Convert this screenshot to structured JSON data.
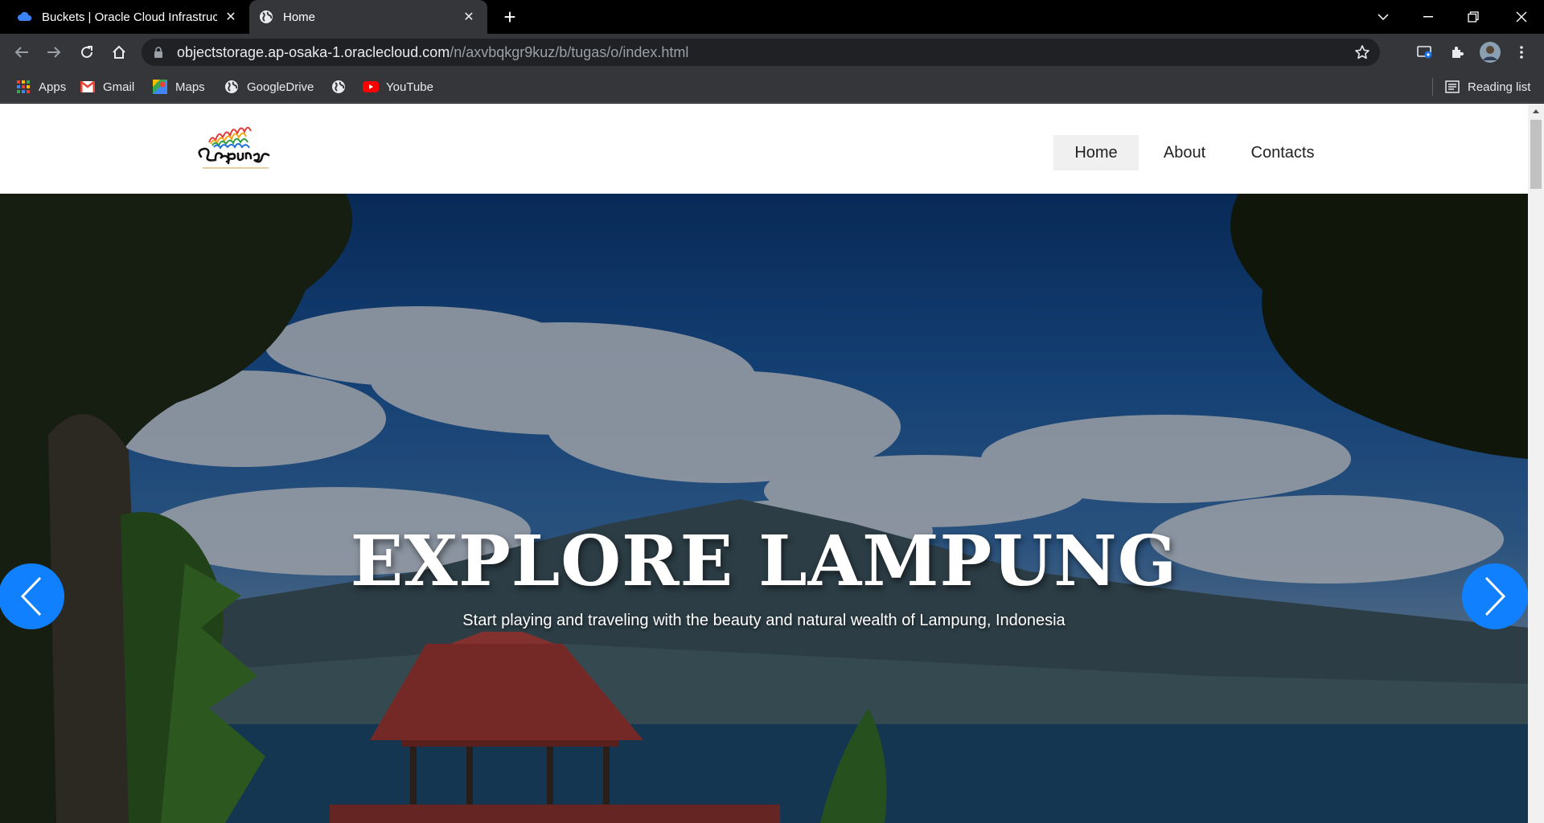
{
  "browser": {
    "tabs": [
      {
        "title": "Buckets | Oracle Cloud Infrastruct",
        "active": false
      },
      {
        "title": "Home",
        "active": true
      }
    ],
    "new_tab_symbol": "+",
    "address": {
      "host": "objectstorage.ap-osaka-1.oraclecloud.com",
      "path": "/n/axvbqkgr9kuz/b/tugas/o/index.html"
    },
    "bookmarks": [
      {
        "label": "Apps",
        "icon": "apps-grid-icon"
      },
      {
        "label": "Gmail",
        "icon": "gmail-icon"
      },
      {
        "label": "Maps",
        "icon": "maps-icon"
      },
      {
        "label": "GoogleDrive",
        "icon": "globe-icon"
      },
      {
        "label": "",
        "icon": "globe-icon"
      },
      {
        "label": "YouTube",
        "icon": "youtube-icon"
      }
    ],
    "reading_list": "Reading list"
  },
  "site": {
    "nav": [
      {
        "label": "Home",
        "active": true
      },
      {
        "label": "About",
        "active": false
      },
      {
        "label": "Contacts",
        "active": false
      }
    ],
    "hero": {
      "title": "EXPLORE LAMPUNG",
      "subtitle": "Start playing and traveling with the beauty and natural wealth of Lampung, Indonesia"
    }
  },
  "colors": {
    "tab_strip": "#000000",
    "toolbar": "#35363a",
    "carousel_arrow": "#1180ff"
  }
}
